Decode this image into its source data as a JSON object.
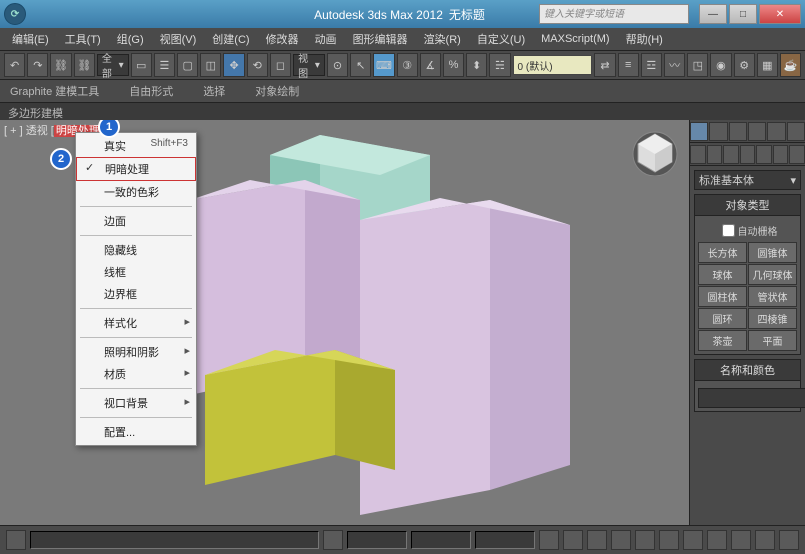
{
  "title": {
    "app": "Autodesk 3ds Max 2012",
    "doc": "无标题"
  },
  "search_placeholder": "键入关键字或短语",
  "menu": [
    "编辑(E)",
    "工具(T)",
    "组(G)",
    "视图(V)",
    "创建(C)",
    "修改器",
    "动画",
    "图形编辑器",
    "渲染(R)",
    "自定义(U)",
    "MAXScript(M)",
    "帮助(H)"
  ],
  "toolbar": {
    "combo1": "全部",
    "combo2": "视图",
    "layer_input": "0 (默认)"
  },
  "ribbon": [
    "Graphite 建模工具",
    "自由形式",
    "选择",
    "对象绘制"
  ],
  "subbar": "多边形建模",
  "viewport_label": {
    "prefix": "[ + ] 透视 [",
    "mode": "明暗处理",
    "suffix": "]"
  },
  "callouts": {
    "a": "1",
    "b": "2"
  },
  "context_menu": [
    {
      "label": "真实",
      "hotkey": "Shift+F3"
    },
    {
      "label": "明暗处理",
      "checked": true,
      "highlight": true
    },
    {
      "label": "一致的色彩"
    },
    {
      "label": "边面",
      "sep_before": true
    },
    {
      "label": "隐藏线",
      "sep_before": true
    },
    {
      "label": "线框"
    },
    {
      "label": "边界框"
    },
    {
      "label": "样式化",
      "sub": true,
      "sep_before": true
    },
    {
      "label": "照明和阴影",
      "sub": true,
      "sep_before": true
    },
    {
      "label": "材质",
      "sub": true
    },
    {
      "label": "视口背景",
      "sub": true,
      "sep_before": true
    },
    {
      "label": "配置...",
      "sep_before": true
    }
  ],
  "panel": {
    "combo": "标准基本体",
    "rollout1_title": "对象类型",
    "autogrid": "自动栅格",
    "buttons": [
      "长方体",
      "圆锥体",
      "球体",
      "几何球体",
      "圆柱体",
      "管状体",
      "圆环",
      "四棱锥",
      "茶壶",
      "平面"
    ],
    "rollout2_title": "名称和颜色"
  },
  "statusbar": {
    "x": "",
    "y": "",
    "z": ""
  }
}
